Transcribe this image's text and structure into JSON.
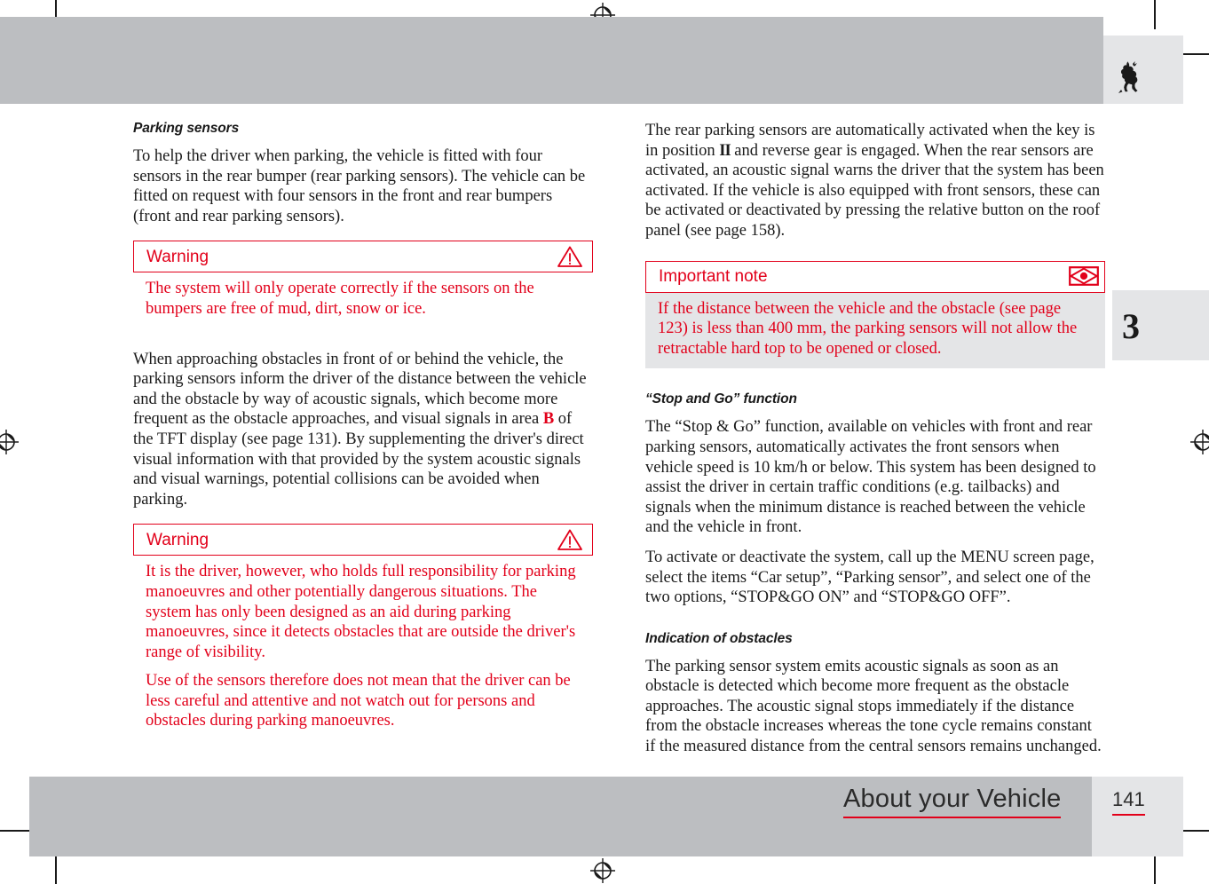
{
  "header": {
    "logo_name": "ferrari-prancing-horse-logo"
  },
  "chapter_tab": {
    "number": "3"
  },
  "footer": {
    "title": "About your Vehicle",
    "page_number": "141"
  },
  "left_column": {
    "heading": "Parking sensors",
    "intro_paragraph": "To help the driver when parking, the vehicle is fitted with four sensors in the rear bumper (rear parking sensors). The vehicle can be fitted on request with four sensors in the front and rear bumpers (front and rear parking sensors).",
    "warning_1": {
      "title": "Warning",
      "icon": "warning-triangle-icon",
      "body": "The system will only operate correctly if the sensors on the bumpers are free of mud, dirt, snow or ice."
    },
    "approach_paragraph_part1": "When approaching obstacles in front of or behind the vehicle, the parking sensors inform the driver of the distance between the vehicle and the obstacle by way of acoustic signals, which become more frequent as the obstacle approaches, and visual signals in area ",
    "approach_paragraph_area_ref": "B",
    "approach_paragraph_part2": " of the TFT display (see page 131). By supplementing the driver's direct visual information with that provided by the system acoustic signals and visual warnings, potential collisions can be avoided when parking.",
    "warning_2": {
      "title": "Warning",
      "icon": "warning-triangle-icon",
      "body_paragraph_1": "It is the driver, however, who holds full responsibility for parking manoeuvres and other potentially dangerous situations. The system has only been designed as an aid during parking manoeuvres, since it detects obstacles that are outside the driver's range of visibility.",
      "body_paragraph_2": "Use of the sensors therefore does not mean that the driver can be less careful and attentive and not watch out for persons and obstacles during parking manoeuvres."
    }
  },
  "right_column": {
    "rear_sensors_part1": "The rear parking sensors are automatically activated when the key is in position ",
    "rear_sensors_key_position": "II",
    "rear_sensors_part2": " and reverse gear is engaged. When the rear sensors are activated, an acoustic signal warns the driver that the system has been activated. If the vehicle is also equipped with front sensors, these can be activated or deactivated by pressing the relative button on the roof panel (see page 158).",
    "important_note": {
      "title": "Important note",
      "icon": "eye-in-rectangle-icon",
      "body": "If the distance between the vehicle and the obstacle (see page 123) is less than 400 mm, the parking sensors will not allow the retractable hard top to be opened or closed."
    },
    "stop_and_go": {
      "heading": "“Stop and Go” function",
      "paragraph_1": "The “Stop & Go” function, available on vehicles with front and rear parking sensors, automatically activates the front sensors when vehicle speed is 10 km/h or below. This system has been designed to assist the driver in certain traffic conditions (e.g. tailbacks) and signals when the minimum distance is reached between the vehicle and the vehicle in front.",
      "paragraph_2": "To activate or deactivate the system, call up the MENU screen page, select the items “Car setup”, “Parking sensor”, and select one of the two options, “STOP&GO ON” and “STOP&GO OFF”."
    },
    "indication_of_obstacles": {
      "heading": "Indication of obstacles",
      "paragraph": "The parking sensor system emits acoustic signals as soon as an obstacle is detected which become more frequent as the obstacle approaches. The acoustic signal stops immediately if the distance from the obstacle increases whereas the tone cycle remains constant if the measured distance from the central sensors remains unchanged."
    }
  },
  "colors": {
    "accent_red": "#e2001a",
    "header_grey": "#bcbec1",
    "panel_grey": "#e4e5e7",
    "text_black": "#1a1a1a"
  }
}
